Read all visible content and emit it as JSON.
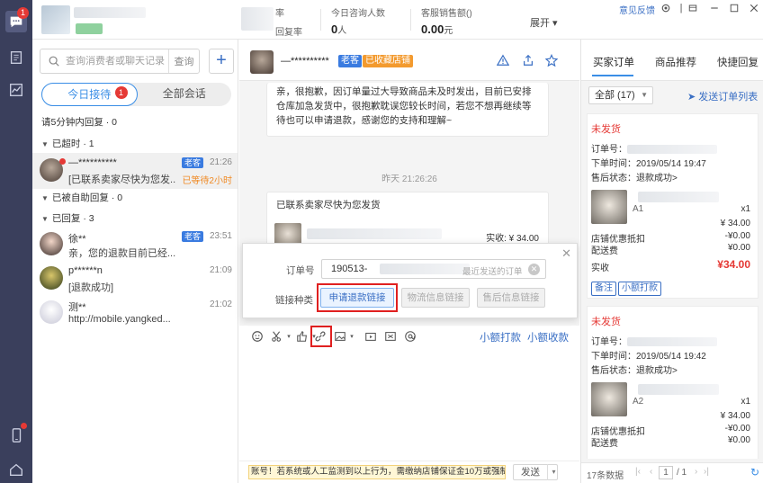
{
  "rail": {
    "chat_badge": "1",
    "colors": {
      "bg": "#3a3f5c",
      "badge": "#e53935"
    }
  },
  "header": {
    "stats": [
      {
        "label": "率",
        "sub": "回复率"
      },
      {
        "label": "今日咨询人数",
        "value": "0",
        "unit": "人"
      },
      {
        "label": "客服销售额()",
        "value": "0.00",
        "unit": "元"
      }
    ],
    "expand": "展开",
    "feedback": "意见反馈"
  },
  "list": {
    "search_placeholder": "查询消费者或聊天记录",
    "search_button": "查询",
    "add_button": "+",
    "tabs": [
      {
        "label": "今日接待",
        "badge": "1"
      },
      {
        "label": "全部会话"
      }
    ],
    "note": "请5分钟内回复 · 0",
    "groups": [
      {
        "label": "已超时 · 1"
      },
      {
        "label": "已被自助回复 · 0"
      },
      {
        "label": "已回复 · 3"
      }
    ],
    "conversations": [
      {
        "name": "—**********",
        "msg": "[已联系卖家尽快为您发...",
        "time": "21:26",
        "tag": "老客",
        "wait": "已等待2小时"
      },
      {
        "name": "徐**",
        "msg": "亲，您的退款目前已经...",
        "time": "23:51",
        "tag": "老客"
      },
      {
        "name": "p******n",
        "msg": "[退款成功]",
        "time": "21:09"
      },
      {
        "name": "测**",
        "msg": "http://mobile.yangked...",
        "time": "21:02"
      }
    ]
  },
  "chat": {
    "name": "—**********",
    "tag_old": "老客",
    "tag_fav": "已收藏店铺",
    "message1": "亲，很抱歉，因订单量过大导致商品未及时发出，目前已安排仓库加急发货中，很抱歉耽误您较长时间，若您不想再继续等待也可以申请退款，感谢您的支持和理解~",
    "timestamp": "昨天 21:26:26",
    "message2_title": "已联系卖家尽快为您发货",
    "paid_label": "实收: ¥ 34.00",
    "toolbar_links": [
      "小额打款",
      "小额收款"
    ],
    "warning": "账号！若系统或人工监测到以上行为，需缴纳店铺保证金10万或强制关店",
    "send": "发送"
  },
  "dialog": {
    "order_label": "订单号",
    "order_prefix": "190513-",
    "order_hint": "最近发送的订单",
    "type_label": "链接种类",
    "buttons": [
      {
        "label": "申请退款链接",
        "active": true
      },
      {
        "label": "物流信息链接",
        "active": false
      },
      {
        "label": "售后信息链接",
        "active": false
      }
    ]
  },
  "right": {
    "tabs": [
      "买家订单",
      "商品推荐",
      "快捷回复"
    ],
    "filter": "全部 (17)",
    "send_order_list": "发送订单列表",
    "orders": [
      {
        "status": "未发货",
        "order_no_label": "订单号：",
        "order_time": "下单时间：2019/05/14 19:47",
        "after_sale": "售后状态：退款成功>",
        "sku": "A1",
        "qty": "x1",
        "price": "¥ 34.00",
        "discount_label": "店铺优惠抵扣",
        "discount": "-¥0.00",
        "gift_label": "配送费",
        "gift": "¥0.00",
        "paid_label": "实收",
        "paid": "¥34.00",
        "buttons": [
          "备注",
          "小额打款"
        ]
      },
      {
        "status": "未发货",
        "order_no_label": "订单号：",
        "order_time": "下单时间：2019/05/14 19:42",
        "after_sale": "售后状态：退款成功>",
        "sku": "A2",
        "qty": "x1",
        "price": "¥ 34.00",
        "discount_label": "店铺优惠抵扣",
        "discount": "-¥0.00",
        "gift_label": "配送费",
        "gift": "¥0.00"
      }
    ],
    "footer_count": "17条数据",
    "page_current": "1",
    "page_total": "/ 1"
  }
}
